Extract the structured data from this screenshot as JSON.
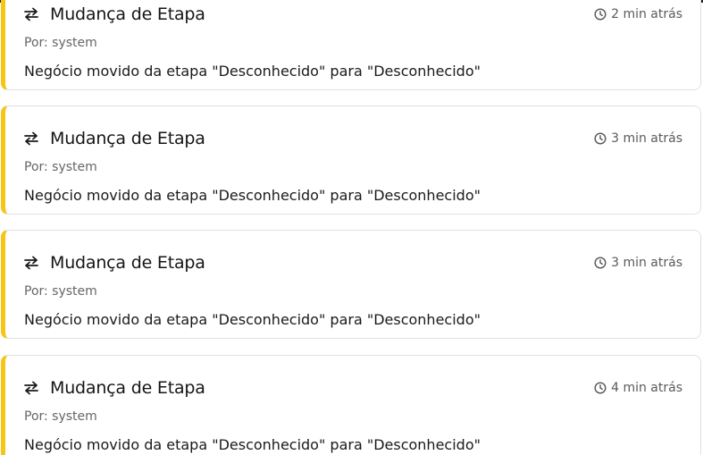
{
  "colors": {
    "accent": "#f5c518",
    "border": "#e1e1e1",
    "title": "#151515",
    "muted": "#666666"
  },
  "events": [
    {
      "icon": "swap-arrows-icon",
      "title": "Mudança de Etapa",
      "time": "2 min atrás",
      "author": "Por: system",
      "message": "Negócio movido da etapa \"Desconhecido\" para \"Desconhecido\""
    },
    {
      "icon": "swap-arrows-icon",
      "title": "Mudança de Etapa",
      "time": "3 min atrás",
      "author": "Por: system",
      "message": "Negócio movido da etapa \"Desconhecido\" para \"Desconhecido\""
    },
    {
      "icon": "swap-arrows-icon",
      "title": "Mudança de Etapa",
      "time": "3 min atrás",
      "author": "Por: system",
      "message": "Negócio movido da etapa \"Desconhecido\" para \"Desconhecido\""
    },
    {
      "icon": "swap-arrows-icon",
      "title": "Mudança de Etapa",
      "time": "4 min atrás",
      "author": "Por: system",
      "message": "Negócio movido da etapa \"Desconhecido\" para \"Desconhecido\""
    }
  ]
}
